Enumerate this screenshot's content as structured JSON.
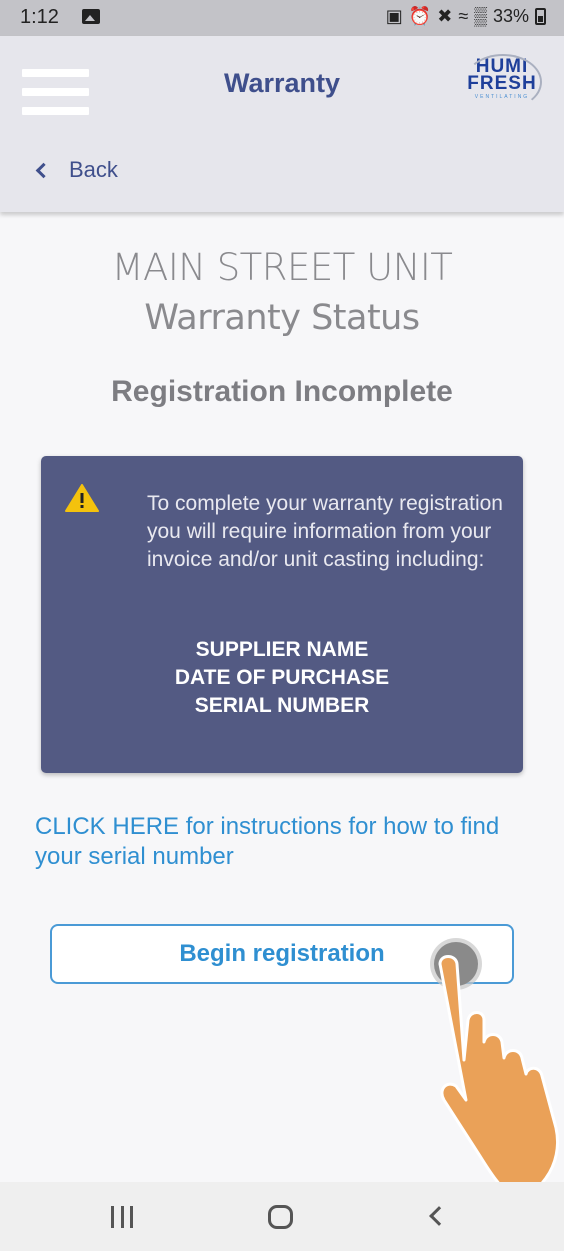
{
  "status_bar": {
    "time": "1:12",
    "battery": "33%",
    "icons": [
      "gallery-icon",
      "lock-icon",
      "alarm-icon",
      "mute-icon",
      "wifi-icon",
      "signal-icon",
      "battery-icon"
    ]
  },
  "header": {
    "title": "Warranty",
    "logo_line1": "HUMI",
    "logo_line2": "FRESH",
    "logo_line3": "VENTILATING",
    "back_label": "Back"
  },
  "main": {
    "unit_name": "MAIN STREET UNIT",
    "subtitle": "Warranty Status",
    "registration_status": "Registration Incomplete",
    "info": {
      "text": "To complete your warranty registration you will require information from your invoice and/or unit casting including:",
      "items": [
        "SUPPLIER NAME",
        "DATE OF PURCHASE",
        "SERIAL NUMBER"
      ]
    },
    "help_link": "CLICK HERE for instructions for how to find your serial number",
    "begin_button": "Begin registration"
  },
  "colors": {
    "header_title": "#3f4f8c",
    "card_bg": "#535a83",
    "link": "#2f8fd1",
    "warning": "#f4c20d"
  }
}
